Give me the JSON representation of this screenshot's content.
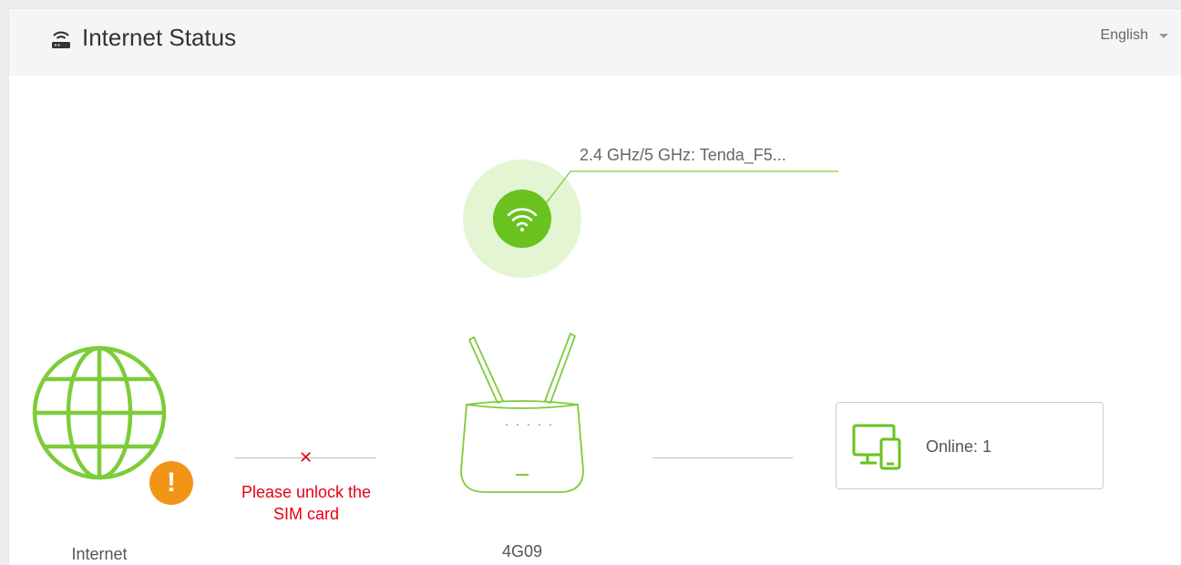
{
  "header": {
    "title": "Internet Status",
    "language": "English"
  },
  "wifi": {
    "ssid_label": "2.4 GHz/5 GHz: Tenda_F5..."
  },
  "internet": {
    "label": "Internet",
    "error_line1": "Please unlock the",
    "error_line2": "SIM card"
  },
  "router": {
    "label": "4G09"
  },
  "clients": {
    "online_label": "Online:",
    "online_count": "1"
  },
  "colors": {
    "accent_green": "#6ac21f",
    "error_red": "#e60012",
    "warning_orange": "#f29517"
  }
}
